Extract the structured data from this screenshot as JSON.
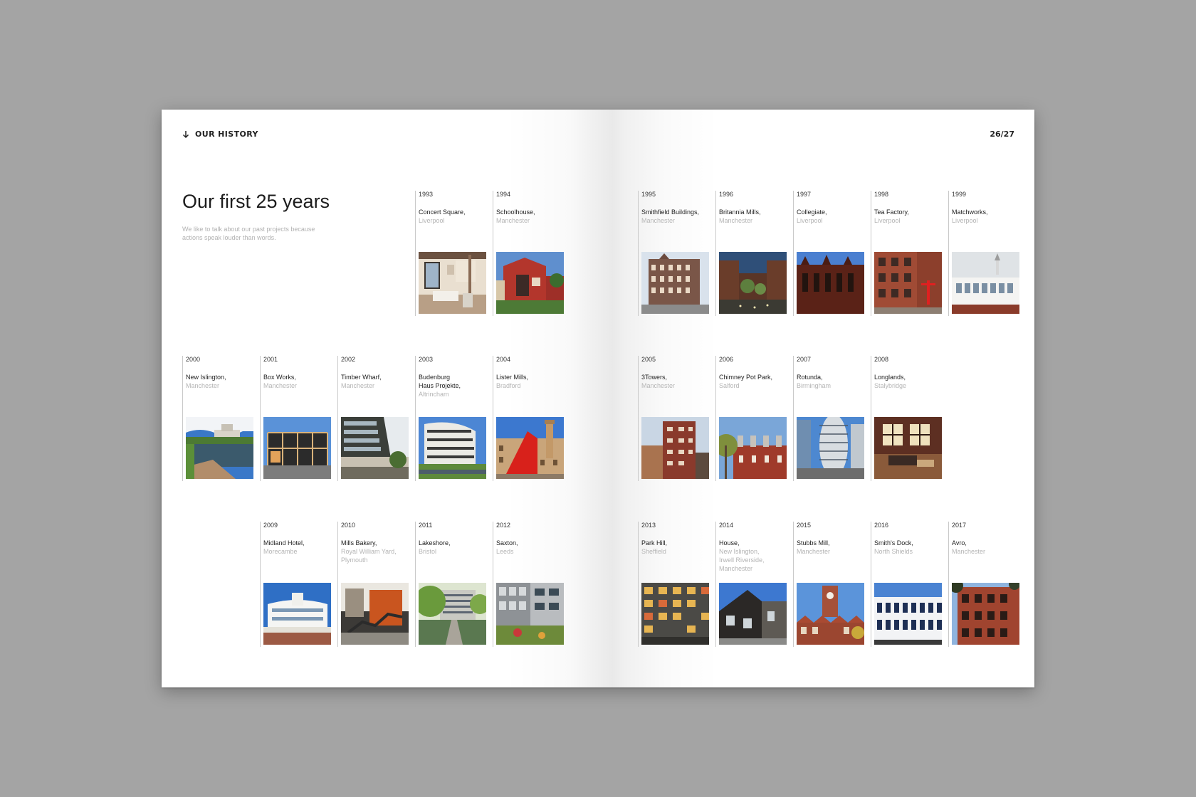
{
  "header": {
    "section_label": "OUR HISTORY",
    "page_numbers": "26/27"
  },
  "intro": {
    "title": "Our first 25 years",
    "text": "We like to talk about our past projects because actions speak louder than words."
  },
  "projects": [
    {
      "year": "1993",
      "name": "Concert Square,",
      "location": "Liverpool"
    },
    {
      "year": "1994",
      "name": "Schoolhouse,",
      "location": "Manchester"
    },
    {
      "year": "1995",
      "name": "Smithfield Buildings,",
      "location": "Manchester"
    },
    {
      "year": "1996",
      "name": "Britannia Mills,",
      "location": "Manchester"
    },
    {
      "year": "1997",
      "name": "Collegiate,",
      "location": "Liverpool"
    },
    {
      "year": "1998",
      "name": "Tea Factory,",
      "location": "Liverpool"
    },
    {
      "year": "1999",
      "name": "Matchworks,",
      "location": "Liverpool"
    },
    {
      "year": "2000",
      "name": "New Islington,",
      "location": "Manchester"
    },
    {
      "year": "2001",
      "name": "Box Works,",
      "location": "Manchester"
    },
    {
      "year": "2002",
      "name": "Timber Wharf,",
      "location": "Manchester"
    },
    {
      "year": "2003",
      "name": "Budenburg Haus Projekte,",
      "location": "Altrincham"
    },
    {
      "year": "2004",
      "name": "Lister Mills,",
      "location": "Bradford"
    },
    {
      "year": "2005",
      "name": "3Towers,",
      "location": "Manchester"
    },
    {
      "year": "2006",
      "name": "Chimney Pot Park,",
      "location": "Salford"
    },
    {
      "year": "2007",
      "name": "Rotunda,",
      "location": "Birmingham"
    },
    {
      "year": "2008",
      "name": "Longlands,",
      "location": "Stalybridge"
    },
    {
      "year": "2009",
      "name": "Midland Hotel,",
      "location": "Morecambe"
    },
    {
      "year": "2010",
      "name": "Mills Bakery,",
      "location": "Royal William Yard, Plymouth"
    },
    {
      "year": "2011",
      "name": "Lakeshore,",
      "location": "Bristol"
    },
    {
      "year": "2012",
      "name": "Saxton,",
      "location": "Leeds"
    },
    {
      "year": "2013",
      "name": "Park Hill,",
      "location": "Sheffield"
    },
    {
      "year": "2014",
      "name": "House,",
      "location": "New Islington, Irwell Riverside, Manchester"
    },
    {
      "year": "2015",
      "name": "Stubbs Mill,",
      "location": "Manchester"
    },
    {
      "year": "2016",
      "name": "Smith's Dock,",
      "location": "North Shields"
    },
    {
      "year": "2017",
      "name": "Avro,",
      "location": "Manchester"
    }
  ]
}
